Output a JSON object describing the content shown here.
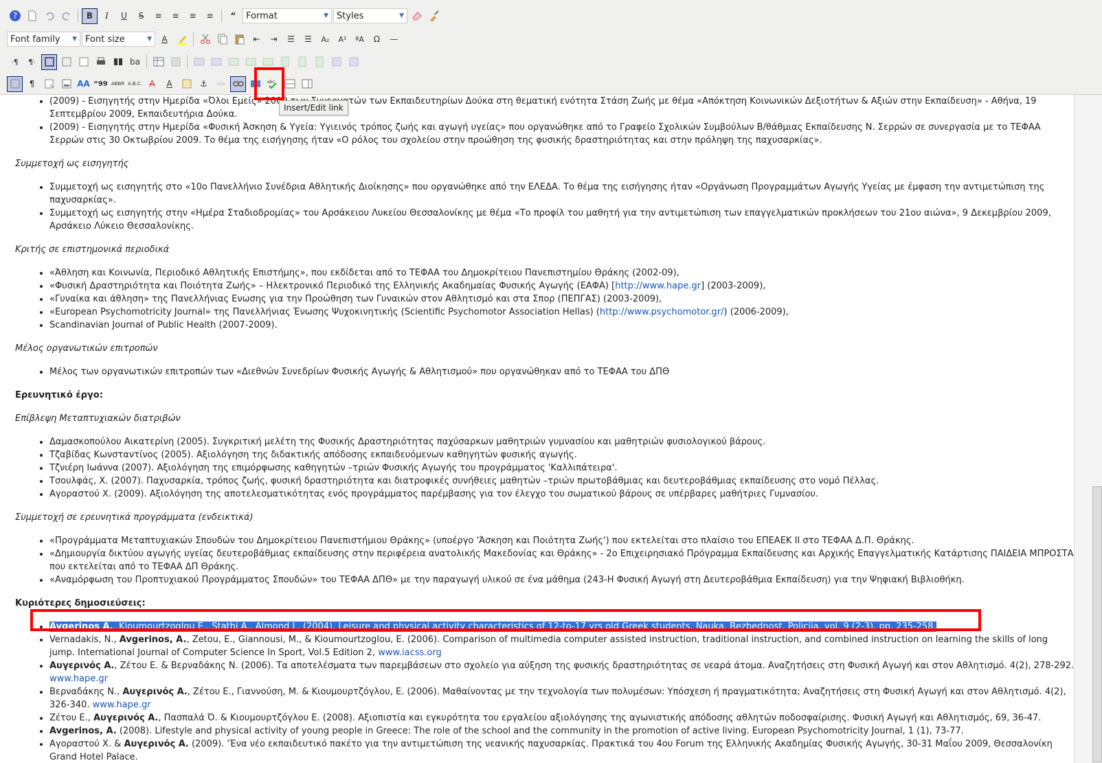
{
  "toolbar": {
    "format_label": "Format",
    "styles_label": "Styles",
    "font_family_label": "Font family",
    "font_size_label": "Font size",
    "tooltip": "Insert/Edit link"
  },
  "content": {
    "list1": [
      {
        "text": "(2009) - Εισηγητής στην Ημερίδα «Όλοι Εμείς» 2009 των Συνεργατών των Εκπαιδευτηρίων Δούκα στη θεματική ενότητα Στάση Ζωής με θέμα «Απόκτηση Κοινωνικών Δεξιοτήτων & Αξιών στην Εκπαίδευση» - Αθήνα, 19 Σεπτεμβρίου 2009, Εκπαιδευτήρια Δούκα."
      },
      {
        "text": "(2009) - Εισηγητής στην Ημερίδα «Φυσική Άσκηση & Υγεία: Υγιεινός τρόπος ζωής και αγωγή υγείας» που οργανώθηκε από το Γραφείο Σχολικών Συμβούλων Β/θάθμιας Εκπαίδευσης Ν. Σερρών σε συνεργασία με το ΤΕΦΑΑ Σερρών στις 30 Οκτωβρίου 2009. Το θέμα της εισήγησης ήταν «Ο ρόλος του σχολείου στην προώθηση της φυσικής δραστηριότητας και στην πρόληψη της παχυσαρκίας»."
      }
    ],
    "heading_speaker": "Συμμετοχή ως εισηγητής",
    "list2": [
      "Συμμετοχή ως εισηγητής στο «10ο Πανελλήνιο Συνέδρια Αθλητικής Διοίκησης» που οργανώθηκε από την ΕΛΕΔΑ. Το θέμα της εισήγησης ήταν «Οργάνωση Προγραμμάτων Αγωγής Υγείας με έμφαση την αντιμετώπιση της παχυσαρκίας».",
      "Συμμετοχή ως εισηγητής στην «Ημέρα Σταδιοδρομίας» του Αρσάκειου Λυκείου Θεσσαλονίκης με θέμα «Το προφίλ του μαθητή για την αντιμετώπιση των επαγγελματικών προκλήσεων του 21ου αιώνα», 9 Δεκεμβρίου 2009, Αρσάκειο Λύκειο Θεσσαλονίκης."
    ],
    "heading_reviewer": "Κριτής σε επιστημονικά περιοδικά",
    "list3": [
      {
        "pre": "«Άθληση και Κοινωνία, Περιοδικό Αθλητικής Επιστήμης», που εκδίδεται από το ΤΕΦΑΑ του Δημοκρίτειου Πανεπιστημίου Θράκης (2002-09),",
        "link": "",
        "post": ""
      },
      {
        "pre": "«Φυσική Δραστηριότητα και Ποιότητα Ζωής» – Ηλεκτρονικό Περιοδικό της Ελληνικής Ακαδημαίας Φυσικής Αγωγής (ΕΑΦΑ) [",
        "link": "http://www.hape.gr",
        "post": "] (2003-2009),"
      },
      {
        "pre": "«Γυναίκα και άθληση» της Πανελλήνιας Ενωσης για την Προώθηση των Γυναικών στον Αθλητισμό και στα Σπορ (ΠΕΠΓΑΣ) (2003-2009),",
        "link": "",
        "post": ""
      },
      {
        "pre": "«European Psychomotricity Journal» της Πανελλήνιας Ένωσης Ψυχοκινητικής (Scientific Psychomotor Association Hellas) (",
        "link": "http://www.psychomotor.gr/",
        "post": ") (2006-2009),"
      },
      {
        "pre": "Scandinavian Journal of Public Health (2007-2009).",
        "link": "",
        "post": ""
      }
    ],
    "heading_committee": "Μέλος οργανωτικών επιτροπών",
    "list4": [
      "Μέλος των οργανωτικών επιτροπών των «Διεθνών Συνεδρίων Φυσικής Αγωγής & Αθλητισμού» που οργανώθηκαν από το ΤΕΦΑΑ του ΔΠΘ"
    ],
    "heading_research": "Ερευνητικό έργο:",
    "heading_supervision": "Επίβλεψη Μεταπτυχιακών διατριβών",
    "list5": [
      "Δαμασκοπούλου Αικατερίνη (2005). Συγκριτική μελέτη της Φυσικής Δραστηριότητας παχύσαρκων μαθητριών γυμνασίου και μαθητριών φυσιολογικού βάρους.",
      "Τζαβίδας Κωνσταντίνος (2005). Αξιολόγηση της διδακτικής απόδοσης εκπαιδευόμενων καθηγητών φυσικής αγωγής.",
      "Τζνιέρη Ιωάννα (2007). Αξιολόγηση της επιμόρφωσης καθηγητών –τριών Φυσικής Αγωγής του προγράμματος 'Καλλιπάτειρα'.",
      "Τσουλφάς, Χ. (2007). Παχυσαρκία, τρόπος ζωής, φυσική δραστηριότητα και διατροφικές συνήθειες μαθητών –τριών πρωτοβάθμιας και δευτεροβάθμιας εκπαίδευσης στο νομό Πέλλας.",
      "Αγοραστού Χ. (2009). Αξιολόγηση της αποτελεσματικότητας ενός προγράμματος παρέμβασης για τον έλεγχο του σωματικού βάρους σε υπέρβαρες μαθήτριες Γυμνασίου."
    ],
    "heading_projects": "Συμμετοχή σε ερευνητικά προγράμματα (ενδεικτικά)",
    "list6": [
      "«Προγράμματα Μεταπτυχιακών Σπουδών του Δημοκρίτειου Πανεπιστήμιου Θράκης» (υποέργο 'Άσκηση και Ποιότητα Ζωής') που εκτελείται στο πλαίσιο του ΕΠΕΑΕΚ ΙΙ στο ΤΕΦΑΑ Δ.Π. Θράκης.",
      "«Δημιουργία δικτύου αγωγής υγείας δευτεροβάθμιας εκπαίδευσης στην περιφέρεια ανατολικής Μακεδονίας και Θράκης» - 2ο Επιχειρησιακό Πρόγραμμα Εκπαίδευσης και Αρχικής Επαγγελματικής Κατάρτισης ΠΑΙΔΕΙΑ ΜΠΡΟΣΤΑ που εκτελείται από το ΤΕΦΑΑ ΔΠ Θράκης.",
      "«Αναμόρφωση του Προπτυχιακού Προγράμματος Σπουδών» του ΤΕΦΑΑ ΔΠΘ» με την παραγωγή υλικού σε ένα μάθημα (243-Η Φυσική Αγωγή στη Δευτεροβάθμια Εκπαίδευση) για την Ψηφιακή Βιβλιοθήκη."
    ],
    "heading_pubs": "Κυριότερες δημοσιεύσεις:",
    "pubs": [
      {
        "pre": "",
        "bold": "Avgerinos A.",
        "post": ", Kioumourtzoglou E., Stathi A., Almond L. (2004). Leisure and physical activity characteristics of 12-to-17 yrs old Greek students. Nauka, Bezbednost, Policija, vol. 9 (2-3), pp. 235-258.",
        "link": ""
      },
      {
        "pre": "Vernadakis, N., ",
        "bold": "Avgerinos, A.",
        "post": ", Zetou, E., Giannousi, M., & Kioumourtzoglou, E. (2006). Comparison of multimedia computer assisted instruction, traditional instruction, and combined instruction on learning the skills of long jump. International Journal of Computer Science In Sport, Vol.5 Edition 2, ",
        "link": "www.iacss.org"
      },
      {
        "pre": "",
        "bold": "Αυγερινός Α.",
        "post": ", Ζέτου Ε. & Βερναδάκης Ν. (2006). Τα αποτελέσματα των παρεμβάσεων στο σχολείο για αύξηση της φυσικής δραστηριότητας σε νεαρά άτομα. Αναζητήσεις στη Φυσική Αγωγή και στον Αθλητισμό. 4(2), 278-292. ",
        "link": "www.hape.gr"
      },
      {
        "pre": "Βερναδάκης Ν., ",
        "bold": "Αυγερινός Α.",
        "post": ", Ζέτου Ε., Γιαννούση, Μ. & Κιουμουρτζόγλου, Ε. (2006). Μαθαίνοντας με την τεχνολογία των πολυμέσων: Υπόσχεση ή πραγματικότητα; Αναζητήσεις στη Φυσική Αγωγή και στον Αθλητισμό. 4(2), 326-340. ",
        "link": "www.hape.gr"
      },
      {
        "pre": "Ζέτου Ε., ",
        "bold": "Αυγερινός Α.",
        "post": ", Πασπαλά Ό. & Κιουμουρτζόγλου Ε. (2008). Αξιοπιστία και εγκυρότητα του εργαλείου αξιολόγησης της αγωνιστικής απόδοσης αθλητών ποδοσφαίρισης. Φυσική Αγωγή και Αθλητισμός, 69, 36-47.",
        "link": ""
      },
      {
        "pre": "",
        "bold": "Avgerinos, A.",
        "post": " (2008). Lifestyle and physical activity of young people in Greece: The role of the school and the community in the promotion of active living. European Psychomotricity Journal, 1 (1), 73-77.",
        "link": ""
      },
      {
        "pre": "Αγοραστού Χ. & ",
        "bold": "Αυγερινός Α.",
        "post": " (2009). 'Ένα νέο εκπαιδευτικό πακέτο για την αντιμετώπιση της νεανικής παχυσαρκίας. Πρακτικά του 4ου Forum της Ελληνικής Ακαδημίας Φυσικής Αγωγής, 30-31 Μαΐου 2009, Θεσσαλονίκη Grand Hotel Palace.",
        "link": ""
      }
    ]
  }
}
